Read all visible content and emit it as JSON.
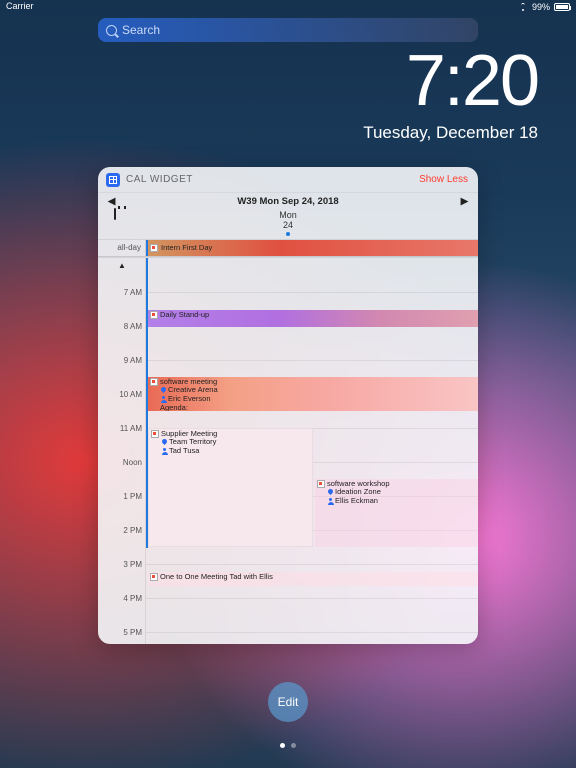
{
  "status": {
    "carrier": "Carrier",
    "battery_pct": "99%"
  },
  "search": {
    "placeholder": "Search"
  },
  "clock": {
    "time": "7:20",
    "date": "Tuesday, December 18"
  },
  "widget": {
    "title": "CAL WIDGET",
    "show_less": "Show Less",
    "week_label": "W39 Mon Sep 24, 2018",
    "day_short": "Mon",
    "day_num": "24",
    "allday_label": "all-day",
    "allday_event": "Intern First Day",
    "hours": [
      "7 AM",
      "8 AM",
      "9 AM",
      "10 AM",
      "11 AM",
      "Noon",
      "1 PM",
      "2 PM",
      "3 PM",
      "4 PM",
      "5 PM"
    ],
    "events": {
      "standup": "Daily Stand-up",
      "soft_meeting": {
        "title": "software meeting",
        "loc": "Creative Arena",
        "who": "Eric Everson",
        "extra": "Agenda:"
      },
      "supplier": {
        "title": "Supplier Meeting",
        "loc": "Team Territory",
        "who": "Tad Tusa"
      },
      "workshop": {
        "title": "software workshop",
        "loc": "Ideation Zone",
        "who": "Ellis Eckman"
      },
      "one_on_one": "One to One Meeting Tad with Ellis"
    }
  },
  "edit_label": "Edit"
}
